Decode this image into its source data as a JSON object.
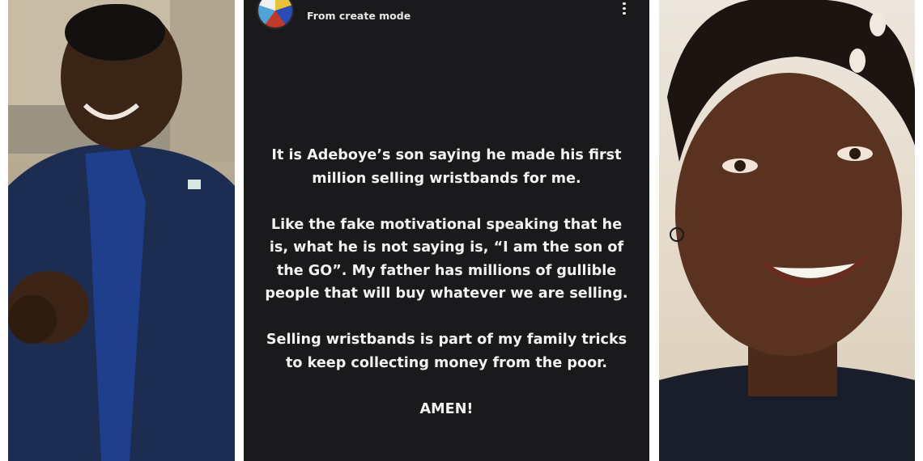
{
  "story": {
    "username": "",
    "mode_label": "From create mode",
    "paragraphs": [
      "It is Adeboye’s son saying he made his first million selling wristbands for me.",
      "Like the fake motivational speaking that he is, what he is not saying is, “I am the son of the GO”.  My father has millions of gullible people that will buy whatever we are selling.",
      "Selling wristbands is part of my family tricks to keep collecting money from the poor.",
      "AMEN!"
    ],
    "background_color": "#1a1a1c",
    "text_color": "#f2f2f2"
  },
  "icons": {
    "menu": "more-vertical-icon"
  }
}
